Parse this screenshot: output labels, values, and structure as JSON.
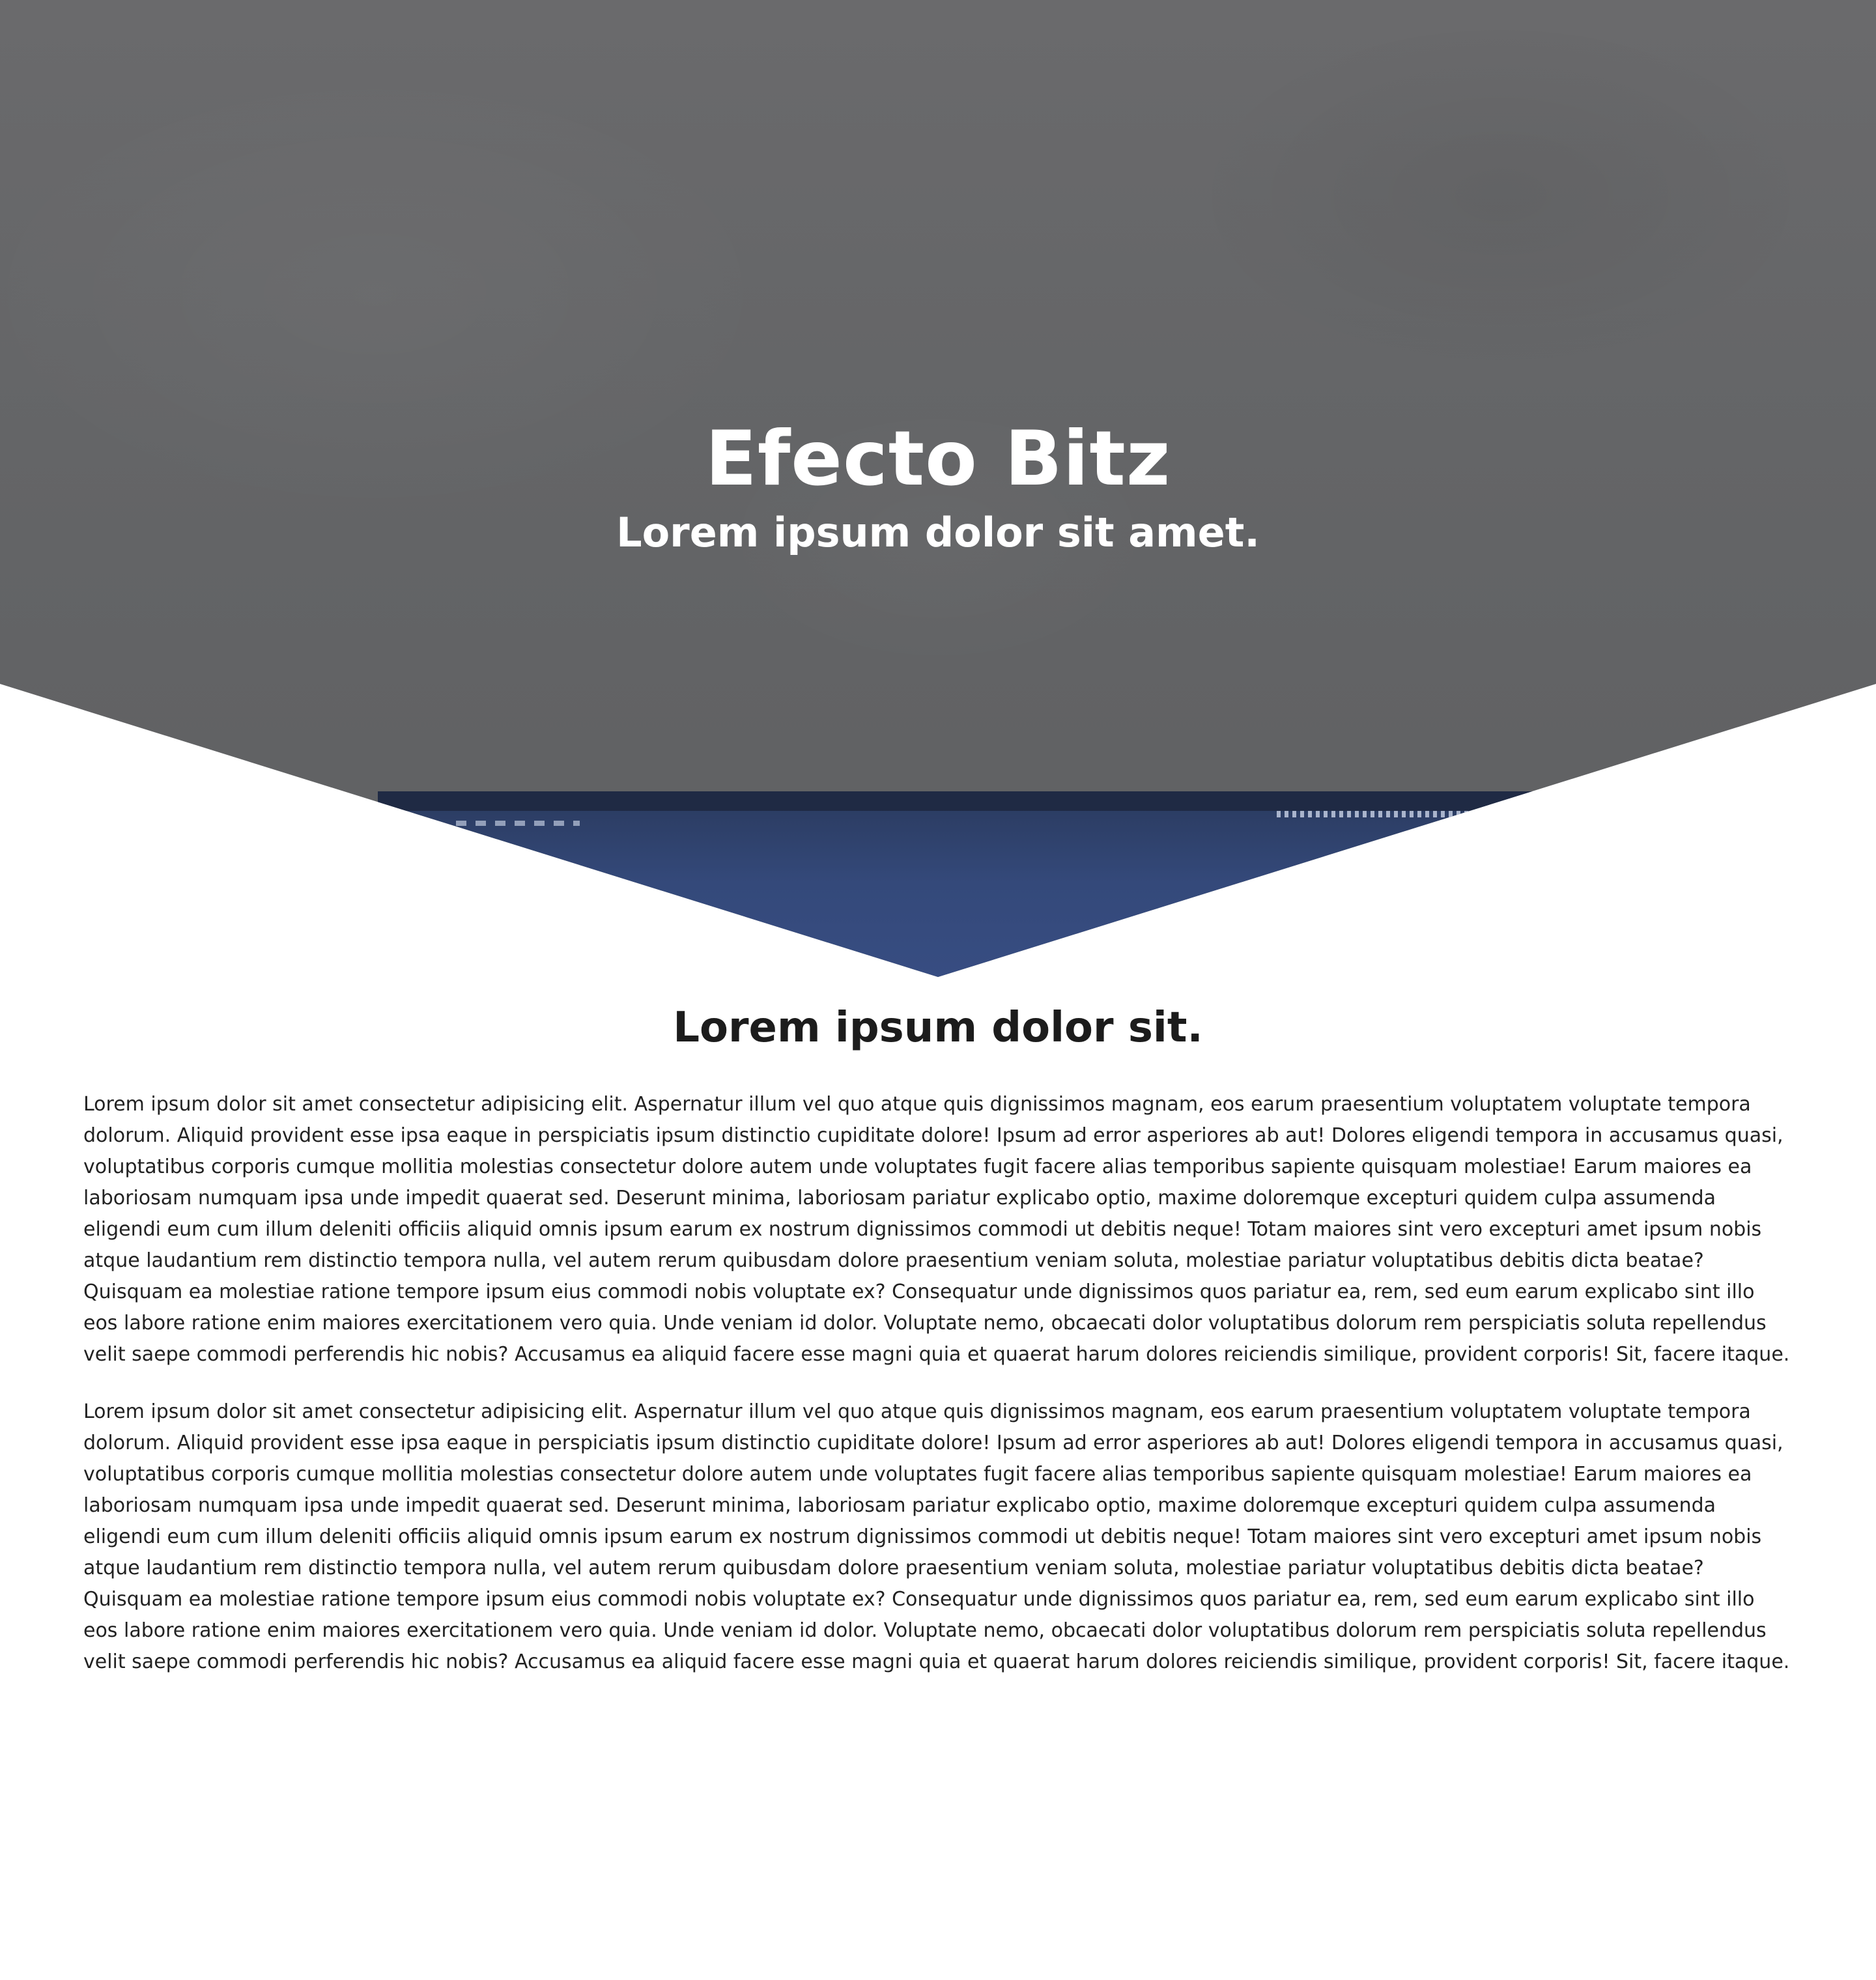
{
  "hero": {
    "title": "Efecto Bitz",
    "subtitle": "Lorem ipsum dolor sit amet."
  },
  "main": {
    "heading": "Lorem ipsum dolor sit.",
    "paragraphs": [
      "Lorem ipsum dolor sit amet consectetur adipisicing elit. Aspernatur illum vel quo atque quis dignissimos magnam, eos earum praesentium voluptatem voluptate tempora dolorum. Aliquid provident esse ipsa eaque in perspiciatis ipsum distinctio cupiditate dolore! Ipsum ad error asperiores ab aut! Dolores eligendi tempora in accusamus quasi, voluptatibus corporis cumque mollitia molestias consectetur dolore autem unde voluptates fugit facere alias temporibus sapiente quisquam molestiae! Earum maiores ea laboriosam numquam ipsa unde impedit quaerat sed. Deserunt minima, laboriosam pariatur explicabo optio, maxime doloremque excepturi quidem culpa assumenda eligendi eum cum illum deleniti officiis aliquid omnis ipsum earum ex nostrum dignissimos commodi ut debitis neque! Totam maiores sint vero excepturi amet ipsum nobis atque laudantium rem distinctio tempora nulla, vel autem rerum quibusdam dolore praesentium veniam soluta, molestiae pariatur voluptatibus debitis dicta beatae? Quisquam ea molestiae ratione tempore ipsum eius commodi nobis voluptate ex? Consequatur unde dignissimos quos pariatur ea, rem, sed eum earum explicabo sint illo eos labore ratione enim maiores exercitationem vero quia. Unde veniam id dolor. Voluptate nemo, obcaecati dolor voluptatibus dolorum rem perspiciatis soluta repellendus velit saepe commodi perferendis hic nobis? Accusamus ea aliquid facere esse magni quia et quaerat harum dolores reiciendis similique, provident corporis! Sit, facere itaque.",
      "Lorem ipsum dolor sit amet consectetur adipisicing elit. Aspernatur illum vel quo atque quis dignissimos magnam, eos earum praesentium voluptatem voluptate tempora dolorum. Aliquid provident esse ipsa eaque in perspiciatis ipsum distinctio cupiditate dolore! Ipsum ad error asperiores ab aut! Dolores eligendi tempora in accusamus quasi, voluptatibus corporis cumque mollitia molestias consectetur dolore autem unde voluptates fugit facere alias temporibus sapiente quisquam molestiae! Earum maiores ea laboriosam numquam ipsa unde impedit quaerat sed. Deserunt minima, laboriosam pariatur explicabo optio, maxime doloremque excepturi quidem culpa assumenda eligendi eum cum illum deleniti officiis aliquid omnis ipsum earum ex nostrum dignissimos commodi ut debitis neque! Totam maiores sint vero excepturi amet ipsum nobis atque laudantium rem distinctio tempora nulla, vel autem rerum quibusdam dolore praesentium veniam soluta, molestiae pariatur voluptatibus debitis dicta beatae? Quisquam ea molestiae ratione tempore ipsum eius commodi nobis voluptate ex? Consequatur unde dignissimos quos pariatur ea, rem, sed eum earum explicabo sint illo eos labore ratione enim maiores exercitationem vero quia. Unde veniam id dolor. Voluptate nemo, obcaecati dolor voluptatibus dolorum rem perspiciatis soluta repellendus velit saepe commodi perferendis hic nobis? Accusamus ea aliquid facere esse magni quia et quaerat harum dolores reiciendis similique, provident corporis! Sit, facere itaque."
    ]
  },
  "colors": {
    "hero_overlay": "#636466",
    "hero_text": "#ffffff",
    "device_screen": "#34497a",
    "page_background": "#ffffff",
    "body_text": "#222222"
  }
}
